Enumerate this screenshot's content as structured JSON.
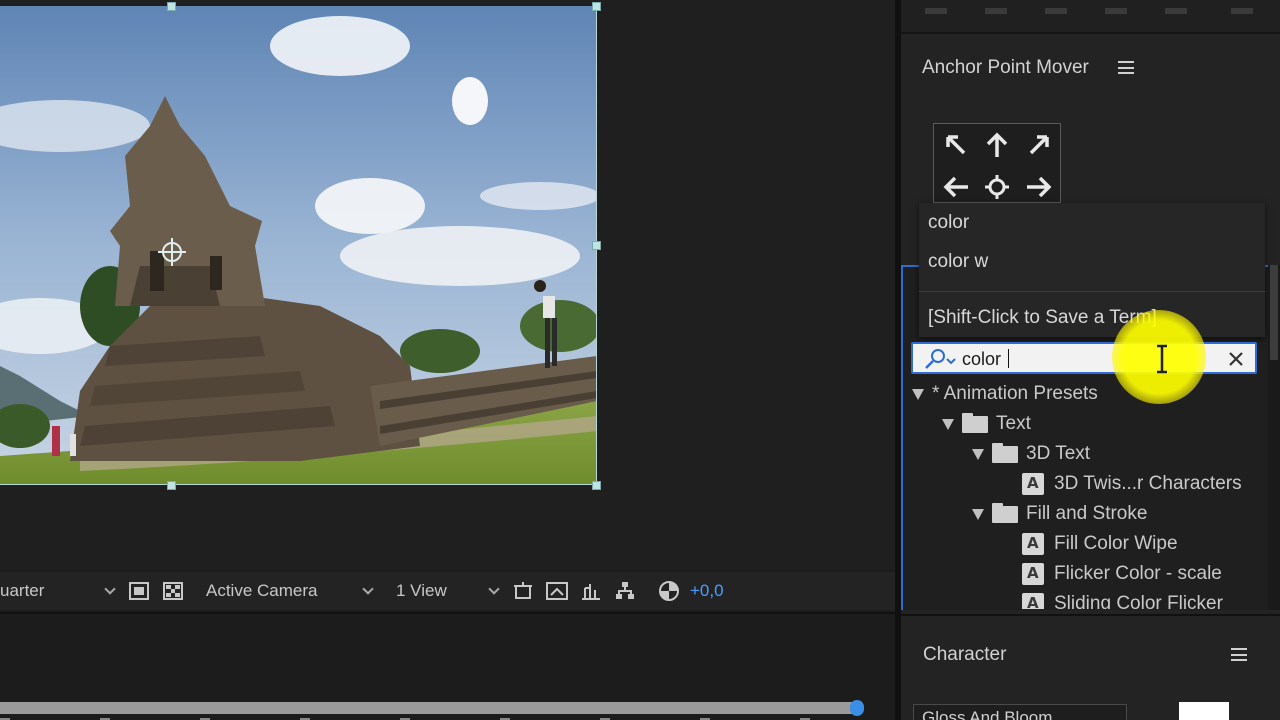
{
  "viewer": {
    "toolbar": {
      "resolution": "uarter",
      "camera": "Active Camera",
      "views": "1 View",
      "exposure": "+0,0"
    }
  },
  "anchor_point_mover": {
    "title": "Anchor Point Mover",
    "arrows": [
      "arrow-up-left-icon",
      "arrow-up-icon",
      "arrow-up-right-icon",
      "arrow-left-icon",
      "crosshair-icon",
      "arrow-right-icon"
    ]
  },
  "search_history": {
    "items": [
      "color",
      "color w"
    ],
    "save_hint": "[Shift-Click to Save a Term]"
  },
  "search": {
    "value": "color"
  },
  "effects_tree": {
    "rows": [
      {
        "label": "* Animation Presets",
        "kind": "root"
      },
      {
        "label": "Text",
        "kind": "folder"
      },
      {
        "label": "3D Text",
        "kind": "folder"
      },
      {
        "label": "3D Twis...r Characters",
        "kind": "preset"
      },
      {
        "label": "Fill and Stroke",
        "kind": "folder"
      },
      {
        "label": "Fill Color Wipe",
        "kind": "preset"
      },
      {
        "label": "Flicker Color - scale",
        "kind": "preset"
      },
      {
        "label": "Sliding Color Flicker",
        "kind": "preset"
      }
    ]
  },
  "character": {
    "title": "Character",
    "font": "Gloss And Bloom"
  },
  "colors": {
    "accent": "#2f6dd5",
    "exposure_text": "#4a9eff",
    "highlight": "#ffff00"
  }
}
